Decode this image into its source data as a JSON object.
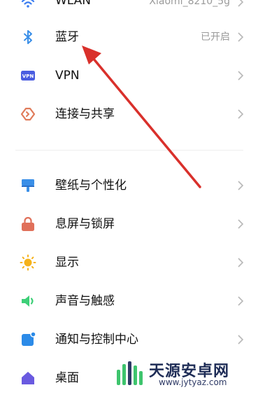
{
  "wlan": {
    "label": "WLAN",
    "value": "Xiaomi_8210_5g"
  },
  "items": [
    {
      "label": "蓝牙",
      "value": "已开启",
      "icon": "bluetooth-icon"
    },
    {
      "label": "VPN",
      "value": "",
      "icon": "vpn-icon"
    },
    {
      "label": "连接与共享",
      "value": "",
      "icon": "connection-share-icon"
    },
    {
      "label": "壁纸与个性化",
      "value": "",
      "icon": "wallpaper-icon"
    },
    {
      "label": "息屏与锁屏",
      "value": "",
      "icon": "lock-icon"
    },
    {
      "label": "显示",
      "value": "",
      "icon": "sun-icon"
    },
    {
      "label": "声音与触感",
      "value": "",
      "icon": "speaker-icon"
    },
    {
      "label": "通知与控制中心",
      "value": "",
      "icon": "notification-icon"
    },
    {
      "label": "桌面",
      "value": "",
      "icon": "home-icon"
    }
  ],
  "watermark": {
    "brand": "天源安卓网",
    "url": "www.jytyaz.com"
  },
  "colors": {
    "arrow": "#d9302b",
    "accent_blue": "#3d7ef0"
  }
}
